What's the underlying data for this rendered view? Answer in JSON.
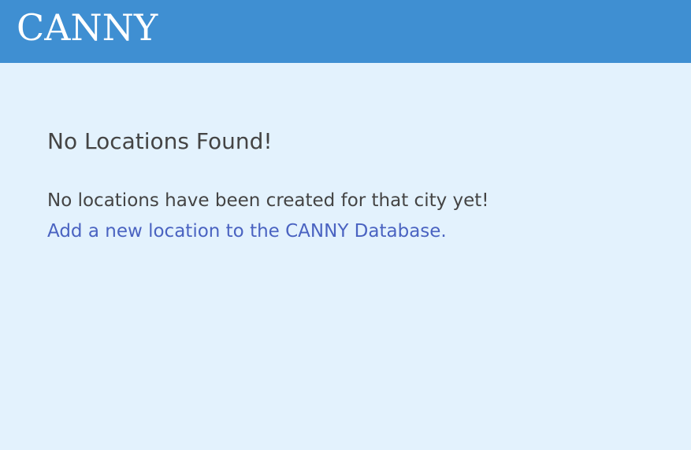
{
  "header": {
    "logo_text": "CANNY",
    "background_color": "#3f8fd2"
  },
  "page": {
    "background_color": "#e3f2fd"
  },
  "main": {
    "heading": "No Locations Found!",
    "message": "No locations have been created for that city yet!",
    "add_link_label": "Add a new location to the CANNY Database."
  },
  "colors": {
    "text": "#444444",
    "link": "#4a63c1"
  }
}
